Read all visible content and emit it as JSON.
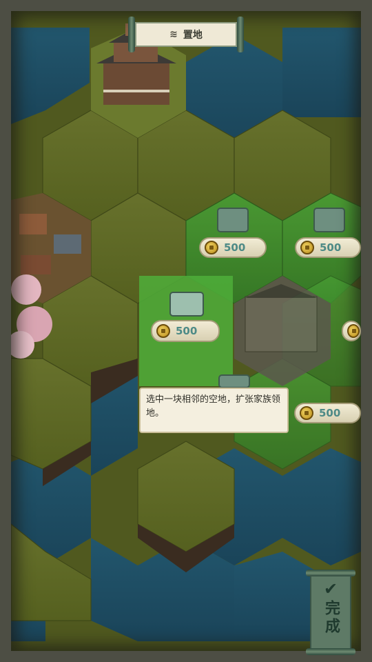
{
  "header": {
    "title": "置地",
    "icon": "land-pattern-icon"
  },
  "plots": [
    {
      "id": "plot-1",
      "cost": "500"
    },
    {
      "id": "plot-2",
      "cost": "500"
    },
    {
      "id": "plot-3",
      "cost": "500"
    },
    {
      "id": "plot-4",
      "cost": "500"
    }
  ],
  "tooltip": {
    "text": "选中一块相邻的空地，扩张家族领地。"
  },
  "done_button": {
    "label": "完成",
    "icon": "checkmark-icon"
  },
  "colors": {
    "grass": "#5c6628",
    "water": "#1d4d63",
    "highlight": "#3f8a2a",
    "parchment": "#f4efdf",
    "cost_text": "#4d8a86"
  }
}
